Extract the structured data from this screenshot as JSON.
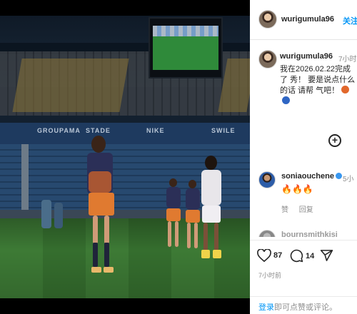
{
  "post": {
    "media": {
      "band_texts": [
        "GROUPAMA",
        "STADE",
        "NIKE",
        "SWILE"
      ],
      "carousel": {
        "count": 7,
        "active_index": 6
      }
    },
    "header": {
      "username": "wurigumula96",
      "follow_label": "关注"
    },
    "caption": {
      "username": "wurigumula96",
      "time": "7小时",
      "text": "我在2026.02.22完成了 秀！ 要是说点什么的话 请帮 气吧！"
    },
    "comments": [
      {
        "username": "soniaouchene",
        "time": "5小",
        "text": "🔥🔥🔥",
        "reply_likes": "赞",
        "reply_label": "回复"
      },
      {
        "username": "bournsmithkisi",
        "time": ""
      }
    ],
    "actions": {
      "likes": "87",
      "comments": "14",
      "posted_ago": "7小时前"
    },
    "login_prompt": {
      "link": "登录",
      "text": "即可点赞或评论。"
    }
  },
  "colors": {
    "accent": "#0095f6",
    "orange_dot": "#e2682c",
    "blue_dot": "#2f66c4",
    "fire": "#e8542a"
  },
  "icons": [
    "more-icon",
    "plus-circle-icon",
    "heart-icon",
    "comment-icon",
    "share-icon",
    "verified-icon",
    "fire-emoji"
  ]
}
